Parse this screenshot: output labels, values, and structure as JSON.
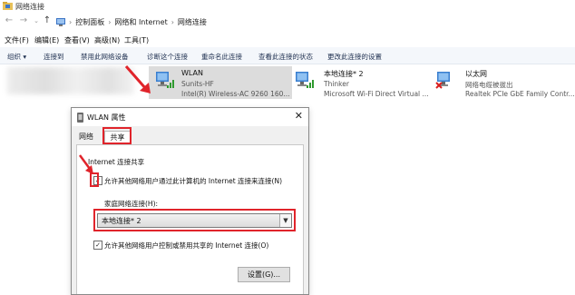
{
  "window": {
    "title": "网络连接"
  },
  "address": {
    "crumbs": [
      "控制面板",
      "网络和 Internet",
      "网络连接"
    ]
  },
  "menu": [
    "文件(F)",
    "编辑(E)",
    "查看(V)",
    "高级(N)",
    "工具(T)"
  ],
  "toolbar": [
    "组织 ▾",
    "连接到",
    "禁用此网络设备",
    "诊断这个连接",
    "重命名此连接",
    "查看此连接的状态",
    "更改此连接的设置"
  ],
  "adapters": [
    {
      "name": "WLAN",
      "status": "Sunits-HF",
      "device": "Intel(R) Wireless-AC 9260 160...",
      "icon": "wifi-adapter-icon"
    },
    {
      "name": "本地连接* 2",
      "status": "Thinker",
      "device": "Microsoft Wi-Fi Direct Virtual ...",
      "icon": "wifi-adapter-icon"
    },
    {
      "name": "以太网",
      "status": "网络电缆被拔出",
      "device": "Realtek PCIe GbE Family Contr...",
      "icon": "ethernet-disconnected-icon"
    }
  ],
  "dialog": {
    "title": "WLAN 属性",
    "tabs": [
      "网络",
      "共享"
    ],
    "section_title": "Internet 连接共享",
    "allow_share": {
      "checked": true,
      "label": "允许其他网络用户通过此计算机的 Internet 连接来连接(N)"
    },
    "home_label": "家庭网络连接(H):",
    "home_value": "本地连接* 2",
    "allow_control": {
      "checked": true,
      "label": "允许其他网络用户控制或禁用共享的 Internet 连接(O)"
    },
    "settings_button": "设置(G)..."
  },
  "colors": {
    "highlight": "#e0242b",
    "selection": "#dcdcdc"
  }
}
